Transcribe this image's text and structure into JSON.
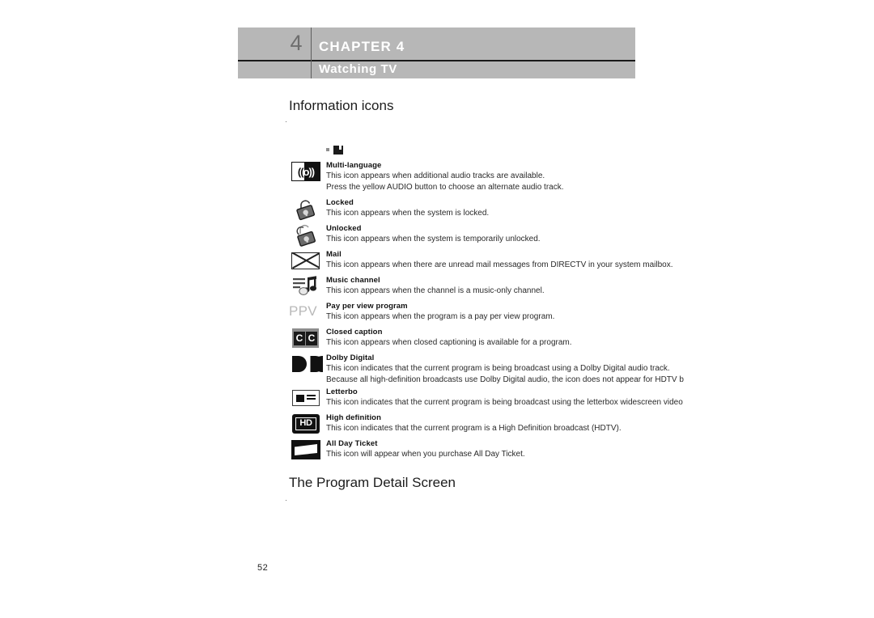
{
  "header": {
    "chapter_number": "4",
    "chapter_title": "CHAPTER 4",
    "chapter_subtitle": "Watching TV"
  },
  "sections": {
    "information_icons_heading": "Information icons",
    "program_detail_heading": "The Program Detail Screen",
    "intro_paragraph_illegible": "............................",
    "detail_paragraph_illegible": "................................."
  },
  "icons": [
    {
      "icon": "multi-language-icon",
      "label": "Multi-language",
      "lines": [
        "This icon appears when additional audio tracks are available.",
        "Press the yellow AUDIO button to choose an alternate audio track."
      ],
      "glyph_left": "((",
      "glyph_right": "o))"
    },
    {
      "icon": "locked-padlock-icon",
      "label": "Locked",
      "lines": [
        "This icon appears when the system is locked."
      ]
    },
    {
      "icon": "unlocked-padlock-icon",
      "label": "Unlocked",
      "lines": [
        "This icon appears when the system is temporarily unlocked."
      ]
    },
    {
      "icon": "mail-envelope-icon",
      "label": "Mail",
      "lines": [
        "This icon appears when there are unread mail messages from DIRECTV in your system mailbox."
      ]
    },
    {
      "icon": "music-note-icon",
      "label": "Music channel",
      "lines": [
        "This icon appears when the channel is a music-only channel."
      ]
    },
    {
      "icon": "ppv-wordmark-icon",
      "label": "Pay per view program",
      "lines": [
        "This icon appears when the program is a pay per view program."
      ],
      "glyph_text": "PPV"
    },
    {
      "icon": "closed-caption-icon",
      "label": "Closed caption",
      "lines": [
        "This icon appears when closed captioning is available for a program."
      ],
      "glyph_left": "C",
      "glyph_right": "C"
    },
    {
      "icon": "dolby-digital-icon",
      "label": "Dolby  Digital",
      "lines": [
        "This icon indicates that the current program is being broadcast using a Dolby Digital audio track.",
        "Because all high-definition broadcasts use Dolby Digital audio, the icon does not appear for HDTV b"
      ]
    },
    {
      "icon": "letterbox-icon",
      "label": "Letterbo",
      "lines": [
        "This icon indicates that the current program is being broadcast using the letterbox widescreen video"
      ]
    },
    {
      "icon": "high-definition-icon",
      "label": "High definition",
      "lines": [
        "This icon indicates that the current program is a High Definition broadcast (HDTV)."
      ],
      "glyph_text": "HD"
    },
    {
      "icon": "all-day-ticket-icon",
      "label": "All Day Ticket",
      "lines": [
        "This icon will appear when you purchase All Day Ticket."
      ]
    }
  ],
  "footer": {
    "page_number": "52"
  },
  "colors": {
    "header_band": "#b7b7b7",
    "header_text": "#ffffff",
    "chapter_number": "#6e6e6e",
    "ppv_gray": "#b9b9b9",
    "body_text": "#2a2a2a"
  }
}
